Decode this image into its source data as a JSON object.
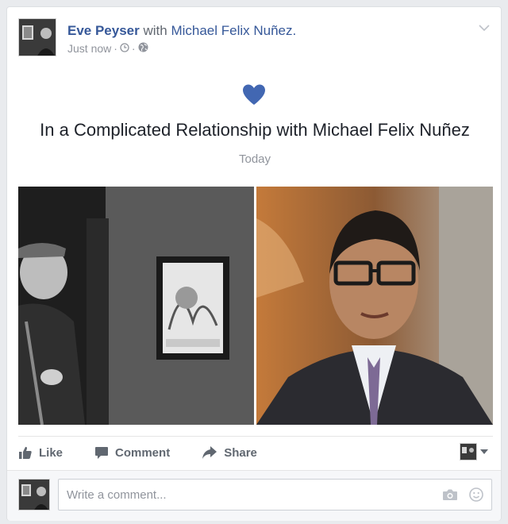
{
  "post": {
    "author": "Eve Peyser",
    "with_word": "with",
    "tagged": "Michael Felix Nuñez.",
    "time": "Just now",
    "separator": "·"
  },
  "event": {
    "icon": "heart-icon",
    "title": "In a Complicated Relationship with Michael Felix Nuñez",
    "date": "Today"
  },
  "actions": {
    "like": "Like",
    "comment": "Comment",
    "share": "Share"
  },
  "comment_box": {
    "placeholder": "Write a comment..."
  },
  "colors": {
    "link": "#365899",
    "heart": "#4267b2",
    "muted": "#90949c"
  }
}
